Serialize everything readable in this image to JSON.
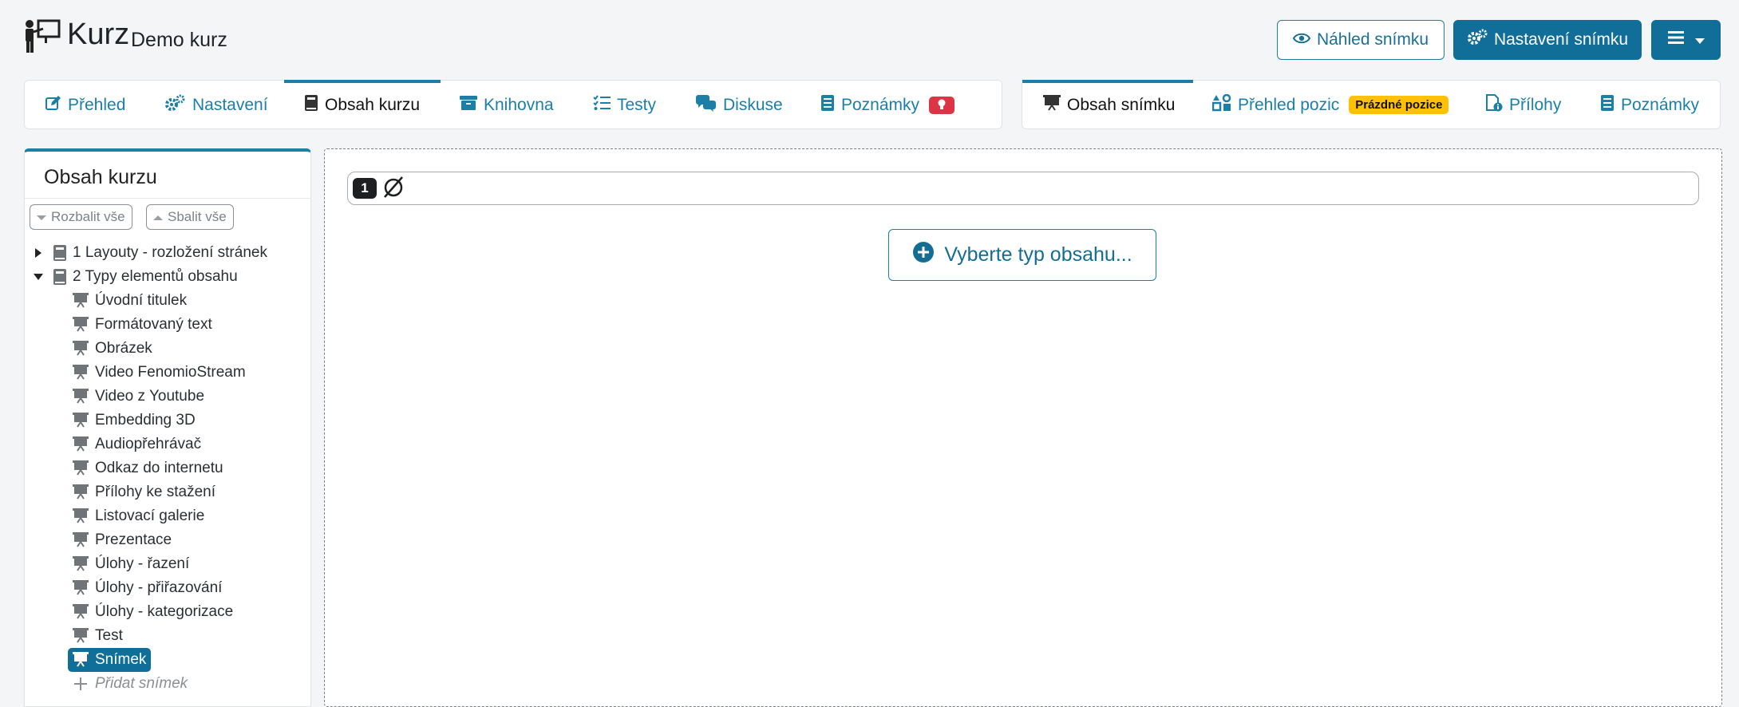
{
  "header": {
    "title": "Kurz",
    "subtitle": "Demo kurz",
    "preview_button": "Náhled snímku",
    "settings_button": "Nastavení snímku",
    "menu_icon": "hamburger-icon"
  },
  "course_tabs": [
    {
      "label": "Přehled",
      "icon": "edit-icon"
    },
    {
      "label": "Nastavení",
      "icon": "gears-icon"
    },
    {
      "label": "Obsah kurzu",
      "icon": "book-icon",
      "active": true
    },
    {
      "label": "Knihovna",
      "icon": "archive-icon"
    },
    {
      "label": "Testy",
      "icon": "checklist-icon"
    },
    {
      "label": "Diskuse",
      "icon": "comments-icon"
    },
    {
      "label": "Poznámky",
      "icon": "notes-icon",
      "badge_icon": "lightbulb-icon"
    }
  ],
  "slide_tabs": [
    {
      "label": "Obsah snímku",
      "icon": "presentation-icon",
      "active": true
    },
    {
      "label": "Přehled pozic",
      "icon": "shapes-icon",
      "badge": "Prázdné pozice"
    },
    {
      "label": "Přílohy",
      "icon": "file-info-icon"
    },
    {
      "label": "Poznámky",
      "icon": "notes-icon"
    }
  ],
  "sidebar": {
    "title": "Obsah kurzu",
    "expand_all": "Rozbalit vše",
    "collapse_all": "Sbalit vše",
    "chapters": [
      {
        "label": "1 Layouty - rozložení stránek",
        "expanded": false
      },
      {
        "label": "2 Typy elementů obsahu",
        "expanded": true
      }
    ],
    "items": [
      "Úvodní titulek",
      "Formátovaný text",
      "Obrázek",
      "Video FenomioStream",
      "Video z Youtube",
      "Embedding 3D",
      "Audiopřehrávač",
      "Odkaz do internetu",
      "Přílohy ke stažení",
      "Listovací galerie",
      "Prezentace",
      "Úlohy - řazení",
      "Úlohy - přiřazování",
      "Úlohy - kategorizace",
      "Test",
      "Snímek"
    ],
    "selected_item": "Snímek",
    "add_slide": "Přidat snímek"
  },
  "main": {
    "slot_number": "1",
    "choose_content": "Vyberte typ obsahu..."
  },
  "colors": {
    "accent": "#1b7fa8",
    "primary_button": "#106e98",
    "badge_red": "#dc3545",
    "badge_yellow": "#ffc107"
  }
}
